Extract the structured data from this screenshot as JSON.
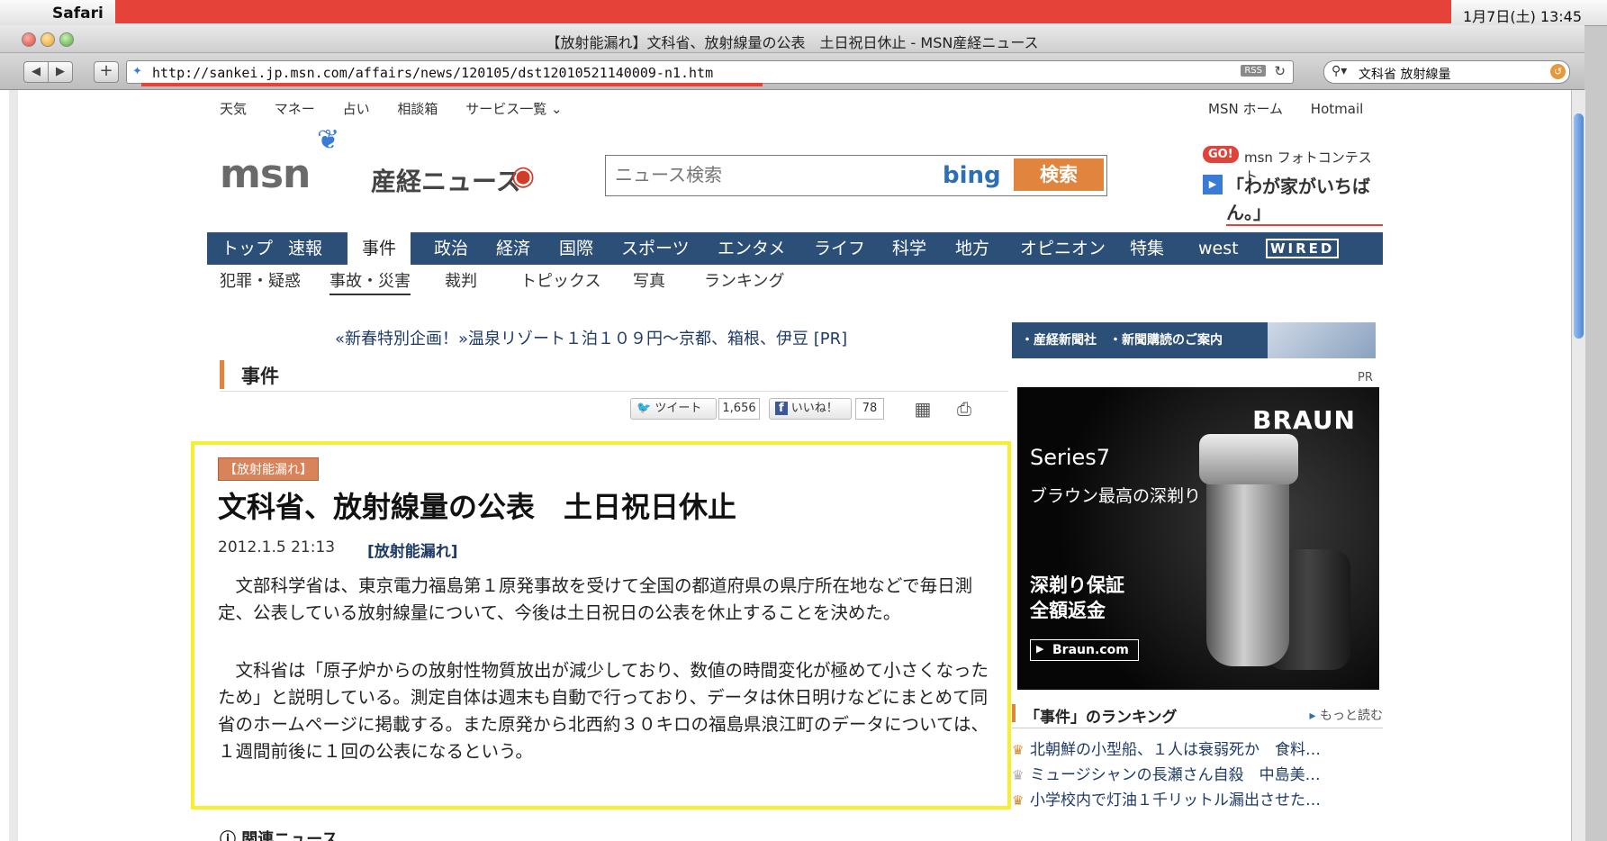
{
  "menubar": {
    "app_name": "Safari",
    "clock": "1月7日(土) 13:45"
  },
  "window": {
    "title": "【放射能漏れ】文科省、放射線量の公表　土日祝日休止 - MSN産経ニュース"
  },
  "toolbar": {
    "back": "◀",
    "forward": "▶",
    "add_bookmark": "+",
    "url": "http://sankei.jp.msn.com/affairs/news/120105/dst12010521140009-n1.htm",
    "rss": "RSS",
    "search_query": "文科省 放射線量"
  },
  "page": {
    "top_links_left": [
      "天気",
      "マネー",
      "占い",
      "相談箱",
      "サービス一覧 ⌄"
    ],
    "top_links_right": [
      "MSN ホーム",
      "Hotmail"
    ],
    "logo_msn": "msn",
    "logo_sankei": "産経ニュース",
    "news_search": {
      "placeholder": "ニュース検索",
      "bing": "bing",
      "button": "検索"
    },
    "photo_contest": {
      "go": "GO!",
      "line1": "msn フォトコンテスト",
      "line2": "「わが家がいちばん。」"
    },
    "main_nav": [
      "トップ",
      "速報",
      "事件",
      "政治",
      "経済",
      "国際",
      "スポーツ",
      "エンタメ",
      "ライフ",
      "科学",
      "地方",
      "オピニオン",
      "特集",
      "west",
      "WIRED"
    ],
    "main_nav_active": "事件",
    "sub_nav": [
      "犯罪・疑惑",
      "事故・災害",
      "裁判",
      "トピックス",
      "写真",
      "ランキング"
    ],
    "sub_nav_active": "事故・災害",
    "promo": "«新春特別企画！»温泉リゾート１泊１０９円～京都、箱根、伊豆 [PR]",
    "category": "事件",
    "social": {
      "tweet": "ツイート",
      "tweet_count": "1,656",
      "like": "いいね！",
      "like_count": "78"
    },
    "article": {
      "tag": "【放射能漏れ】",
      "headline": "文科省、放射線量の公表　土日祝日休止",
      "date": "2012.1.5 21:13",
      "date_tag": "[放射能漏れ]",
      "paragraph1": "文部科学省は、東京電力福島第１原発事故を受けて全国の都道府県の県庁所在地などで毎日測定、公表している放射線量について、今後は土日祝日の公表を休止することを決めた。",
      "paragraph2": "文科省は「原子炉からの放射性物質放出が減少しており、数値の時間変化が極めて小さくなったため」と説明している。測定自体は週末も自動で行っており、データは休日明けなどにまとめて同省のホームページに掲載する。また原発から北西約３０キロの福島県浪江町のデータについては、１週間前後に１回の公表になるという。"
    },
    "related_news": "関連ニュース",
    "subscribe": "・産経新聞社　・新聞購読のご案内",
    "ad": {
      "pr": "PR",
      "brand": "BRAUN",
      "series": "Series7",
      "copy": "ブラウン最高の深剃り",
      "badge1": "深剃り保証",
      "badge2": "全額返金",
      "link": "Braun.com"
    },
    "ranking": {
      "title": "「事件」のランキング",
      "more": "もっと読む",
      "items": [
        "北朝鮮の小型船、１人は衰弱死か　食料…",
        "ミュージシャンの長瀬さん自殺　中島美…",
        "小学校内で灯油１千リットル漏出させた…"
      ]
    }
  }
}
